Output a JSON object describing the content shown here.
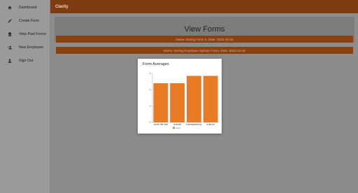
{
  "sidebar": {
    "items": [
      {
        "label": "Dashboard",
        "icon": "home-icon"
      },
      {
        "label": "Create Form",
        "icon": "pencil-icon"
      },
      {
        "label": "View Past Forms",
        "icon": "document-icon"
      },
      {
        "label": "New Employee",
        "icon": "add-person-icon"
      },
      {
        "label": "Sign Out",
        "icon": "person-icon"
      }
    ]
  },
  "header": {
    "title": "Clarity"
  },
  "main": {
    "title": "View Forms",
    "forms": [
      {
        "label": "Name: Boring Form 6, Date: 2023-10-16"
      },
      {
        "label": "Name: Boring Employee Opinion Form, Date: 2023-10-16"
      }
    ]
  },
  "modal": {
    "title": "Form Averages"
  },
  "colors": {
    "accent": "#e87b24",
    "topbar": "#7e3c10",
    "form_row": "#8a4110"
  },
  "chart_data": {
    "type": "bar",
    "title": "Form Averages",
    "categories": [
      "work life bal",
      "overall",
      "transparency",
      "culture"
    ],
    "series": [
      {
        "name": "value",
        "values": [
          4.8,
          4.8,
          5.7,
          5.7
        ],
        "color": "#e87b24"
      }
    ],
    "ylim": [
      0,
      6
    ],
    "yticks": [
      0,
      2,
      4,
      6
    ],
    "ytick_labels": [
      "0",
      "2",
      "4",
      "6"
    ],
    "grid": false,
    "legend": "bottom"
  }
}
